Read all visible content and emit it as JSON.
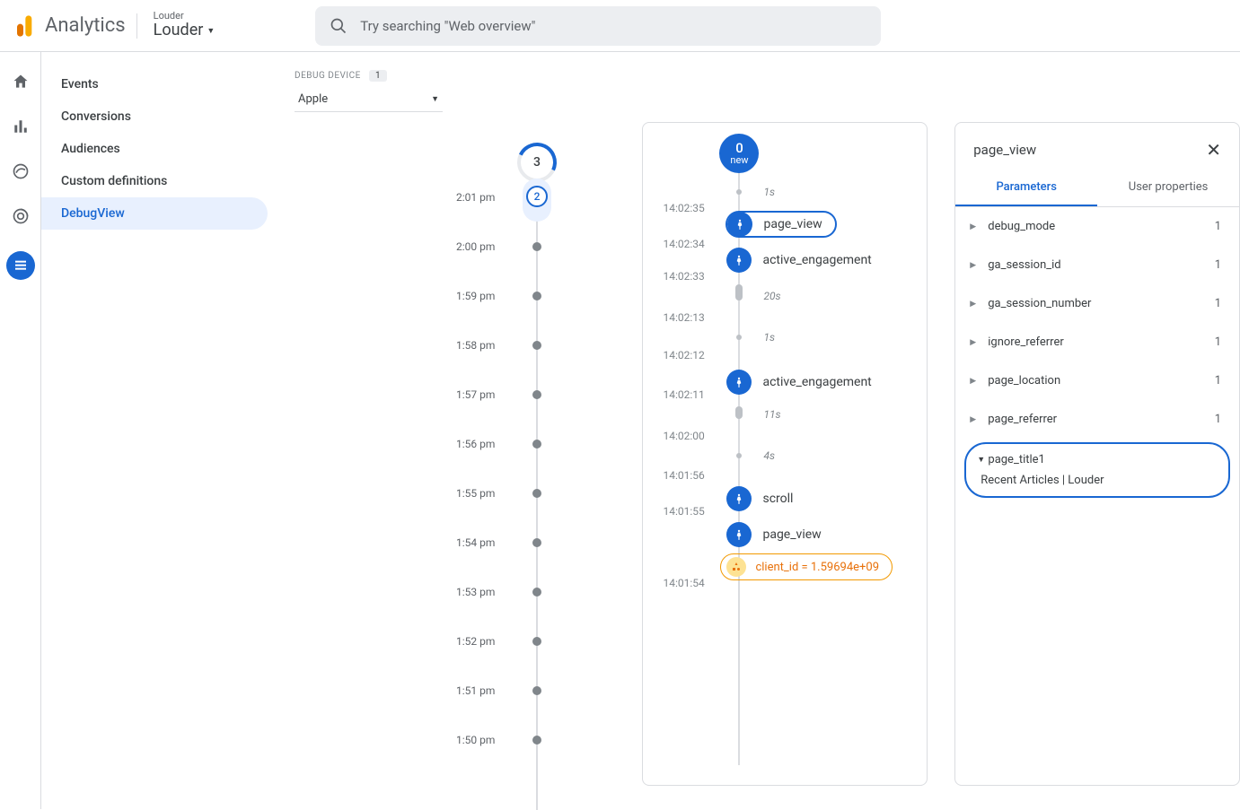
{
  "header": {
    "analytics": "Analytics",
    "property_small": "Louder",
    "property_name": "Louder",
    "search_placeholder": "Try searching \"Web overview\""
  },
  "sidebar": {
    "items": [
      {
        "label": "Events"
      },
      {
        "label": "Conversions"
      },
      {
        "label": "Audiences"
      },
      {
        "label": "Custom definitions"
      },
      {
        "label": "DebugView"
      }
    ]
  },
  "debug": {
    "label": "DEBUG DEVICE",
    "badge": "1",
    "device": "Apple"
  },
  "minute_timeline": {
    "big_count": "3",
    "small_count": "2",
    "labels": [
      "2:01 pm",
      "2:00 pm",
      "1:59 pm",
      "1:58 pm",
      "1:57 pm",
      "1:56 pm",
      "1:55 pm",
      "1:54 pm",
      "1:53 pm",
      "1:52 pm",
      "1:51 pm",
      "1:50 pm"
    ]
  },
  "seconds": {
    "new_count": "0",
    "new_label": "new",
    "items": {
      "gap_1s_a": "1s",
      "ts_35": "14:02:35",
      "page_view_1": "page_view",
      "ts_34": "14:02:34",
      "active_eng_1": "active_engagement",
      "ts_33": "14:02:33",
      "gap_20s": "20s",
      "ts_13": "14:02:13",
      "gap_1s_b": "1s",
      "ts_12": "14:02:12",
      "active_eng_2": "active_engagement",
      "ts_11": "14:02:11",
      "gap_11s": "11s",
      "ts_00": "14:02:00",
      "gap_4s": "4s",
      "ts_56": "14:01:56",
      "scroll": "scroll",
      "ts_55": "14:01:55",
      "page_view_2": "page_view",
      "client_id": "client_id = 1.59694e+09",
      "ts_54": "14:01:54"
    }
  },
  "details": {
    "title": "page_view",
    "tabs": {
      "parameters": "Parameters",
      "user_properties": "User properties"
    },
    "params": [
      {
        "name": "debug_mode",
        "count": "1"
      },
      {
        "name": "ga_session_id",
        "count": "1"
      },
      {
        "name": "ga_session_number",
        "count": "1"
      },
      {
        "name": "ignore_referrer",
        "count": "1"
      },
      {
        "name": "page_location",
        "count": "1"
      },
      {
        "name": "page_referrer",
        "count": "1"
      }
    ],
    "expanded": {
      "name": "page_title",
      "count": "1",
      "value": "Recent Articles | Louder"
    }
  }
}
